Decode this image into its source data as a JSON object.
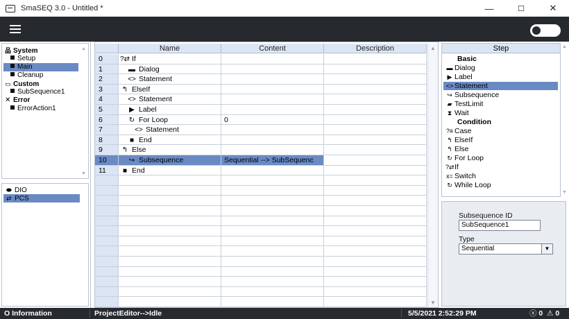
{
  "window": {
    "title": "SmaSEQ 3.0 - Untitled *",
    "minimize": "—",
    "maximize": "☐",
    "close": "✕"
  },
  "tree": {
    "groups": [
      {
        "label": "System",
        "icon": "hierarchy-icon",
        "children": [
          {
            "label": "Setup",
            "selected": false
          },
          {
            "label": "Main",
            "selected": true
          },
          {
            "label": "Cleanup",
            "selected": false
          }
        ]
      },
      {
        "label": "Custom",
        "icon": "folder-icon",
        "children": [
          {
            "label": "SubSequence1",
            "selected": false
          }
        ]
      },
      {
        "label": "Error",
        "icon": "close-icon",
        "children": [
          {
            "label": "ErrorAction1",
            "selected": false
          }
        ]
      }
    ],
    "resources": [
      {
        "label": "DIO",
        "icon": "toggle-icon",
        "selected": false
      },
      {
        "label": "PCS",
        "icon": "swap-icon",
        "selected": true
      }
    ]
  },
  "grid": {
    "columns": [
      "Name",
      "Content",
      "Description"
    ],
    "rows": [
      {
        "index": "0",
        "icon": "?⇄",
        "indent": 0,
        "name": "If",
        "content": "",
        "selected": false
      },
      {
        "index": "1",
        "icon": "▬",
        "indent": 1,
        "name": "Dialog",
        "content": "",
        "selected": false
      },
      {
        "index": "2",
        "icon": "<>",
        "indent": 1,
        "name": "Statement",
        "content": "",
        "selected": false
      },
      {
        "index": "3",
        "icon": "↰",
        "indent": 0,
        "name": "ElseIf",
        "content": "",
        "selected": false
      },
      {
        "index": "4",
        "icon": "<>",
        "indent": 1,
        "name": "Statement",
        "content": "",
        "selected": false
      },
      {
        "index": "5",
        "icon": "▶",
        "indent": 1,
        "name": "Label",
        "content": "",
        "selected": false
      },
      {
        "index": "6",
        "icon": "↻",
        "indent": 1,
        "name": "For Loop",
        "content": "0",
        "selected": false
      },
      {
        "index": "7",
        "icon": "<>",
        "indent": 2,
        "name": "Statement",
        "content": "",
        "selected": false
      },
      {
        "index": "8",
        "icon": "■",
        "indent": 1,
        "name": "End",
        "content": "",
        "selected": false
      },
      {
        "index": "9",
        "icon": "↰",
        "indent": 0,
        "name": "Else",
        "content": "",
        "selected": false
      },
      {
        "index": "10",
        "icon": "↪",
        "indent": 1,
        "name": "Subsequence",
        "content": "Sequential --> SubSequenc",
        "selected": true
      },
      {
        "index": "11",
        "icon": "■",
        "indent": 0,
        "name": "End",
        "content": "",
        "selected": false
      }
    ]
  },
  "steps": {
    "header": "Step",
    "items": [
      {
        "type": "cat",
        "label": "Basic"
      },
      {
        "type": "item",
        "icon": "▬",
        "label": "Dialog",
        "icon_name": "dialog-icon"
      },
      {
        "type": "item",
        "icon": "▶",
        "label": "Label",
        "icon_name": "label-icon"
      },
      {
        "type": "item",
        "icon": "<>",
        "label": "Statement",
        "icon_name": "code-icon",
        "selected": true
      },
      {
        "type": "item",
        "icon": "↪",
        "label": "Subsequence",
        "icon_name": "subsequence-icon"
      },
      {
        "type": "item",
        "icon": "▰",
        "label": "TestLimit",
        "icon_name": "testlimit-icon"
      },
      {
        "type": "item",
        "icon": "⧗",
        "label": "Wait",
        "icon_name": "hourglass-icon"
      },
      {
        "type": "cat",
        "label": "Condition"
      },
      {
        "type": "item",
        "icon": "?≡",
        "label": "Case",
        "icon_name": "case-icon"
      },
      {
        "type": "item",
        "icon": "↰",
        "label": "ElseIf",
        "icon_name": "elseif-icon"
      },
      {
        "type": "item",
        "icon": "↰",
        "label": "Else",
        "icon_name": "else-icon"
      },
      {
        "type": "item",
        "icon": "↻",
        "label": "For Loop",
        "icon_name": "loop-icon"
      },
      {
        "type": "item",
        "icon": "?⇄",
        "label": "If",
        "icon_name": "if-icon"
      },
      {
        "type": "item",
        "icon": "x=",
        "label": "Switch",
        "icon_name": "switch-icon"
      },
      {
        "type": "item",
        "icon": "↻",
        "label": "While Loop",
        "icon_name": "while-icon"
      }
    ]
  },
  "properties": {
    "id_label": "Subsequence ID",
    "id_value": "SubSequence1",
    "type_label": "Type",
    "type_value": "Sequential"
  },
  "status": {
    "info": "Information",
    "info_icon": "O",
    "editor_state": "ProjectEditor-->Idle",
    "datetime": "5/5/2021 2:52:29 PM",
    "errors": "0",
    "warnings": "0"
  },
  "colors": {
    "header_bg": "#26292e",
    "selection": "#6a8ac4",
    "grid_header": "#dbe5f3"
  }
}
